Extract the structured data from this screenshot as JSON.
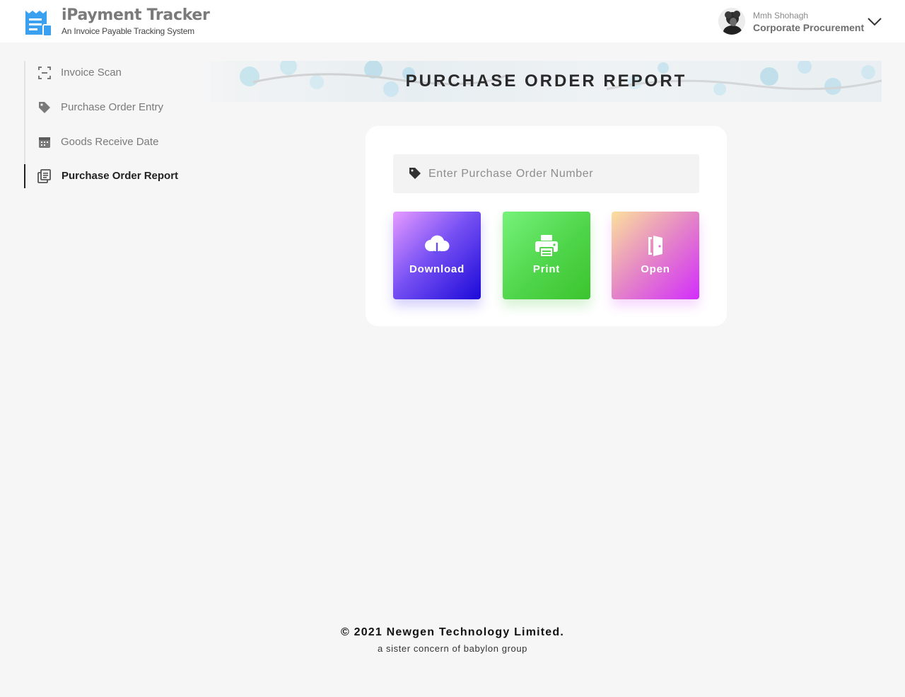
{
  "header": {
    "app_title": "iPayment Tracker",
    "app_subtitle": "An Invoice Payable Tracking System",
    "user_name": "Mmh Shohagh",
    "user_department": "Corporate Procurement",
    "logo_icon": "receipt-document-icon",
    "menu_icon": "chevron-down-icon"
  },
  "sidebar": {
    "items": [
      {
        "label": "Invoice Scan",
        "icon": "scan-icon",
        "active": false
      },
      {
        "label": "Purchase Order Entry",
        "icon": "tag-icon",
        "active": false
      },
      {
        "label": "Goods Receive Date",
        "icon": "calendar-icon",
        "active": false
      },
      {
        "label": "Purchase Order Report",
        "icon": "report-clipboard-icon",
        "active": true
      }
    ]
  },
  "main": {
    "page_title": "PURCHASE ORDER REPORT",
    "search": {
      "placeholder": "Enter Purchase Order Number",
      "value": "",
      "icon": "tag-icon"
    },
    "actions": [
      {
        "label": "Download",
        "icon": "cloud-download-icon"
      },
      {
        "label": "Print",
        "icon": "printer-icon"
      },
      {
        "label": "Open",
        "icon": "door-open-icon"
      }
    ]
  },
  "footer": {
    "copyright": "© 2021 Newgen Technology Limited.",
    "tagline": "a sister concern of babylon group"
  },
  "colors": {
    "background": "#f6f6f6",
    "header": "#ffffff",
    "logo_blue": "#3aa0f0",
    "download_gradient": [
      "#e79bff",
      "#1b0ad8"
    ],
    "print_gradient": [
      "#76f27a",
      "#3cc42e"
    ],
    "open_gradient": [
      "#fbe09c",
      "#d22dfc"
    ]
  }
}
